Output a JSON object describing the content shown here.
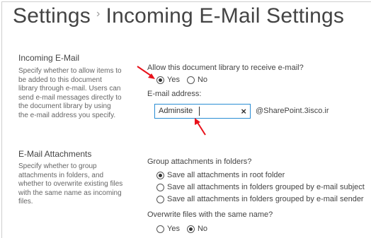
{
  "header": {
    "breadcrumb_root": "Settings",
    "separator": "›",
    "title": "Incoming E-Mail Settings"
  },
  "incoming_email": {
    "heading": "Incoming E-Mail",
    "description_lines": [
      "Specify whether to allow items to",
      "be added to this document",
      "library through e-mail. Users can",
      "send e-mail messages directly to",
      "the document library by using",
      "the e-mail address you specify."
    ],
    "allow_question": "Allow this document library to receive e-mail?",
    "allow_options": [
      {
        "label": "Yes",
        "selected": true
      },
      {
        "label": "No",
        "selected": false
      }
    ],
    "address_label": "E-mail address:",
    "address_value": "Adminsite",
    "address_domain": "@SharePoint.3isco.ir",
    "clear_icon": "×"
  },
  "attachments": {
    "heading": "E-Mail Attachments",
    "description_lines": [
      "Specify whether to group",
      "attachments in folders, and",
      "whether to overwrite existing files",
      "with the same name as incoming",
      "files."
    ],
    "group_question": "Group attachments in folders?",
    "group_options": [
      {
        "label": "Save all attachments in root folder",
        "selected": true
      },
      {
        "label": "Save all attachments in folders grouped by e-mail subject",
        "selected": false
      },
      {
        "label": "Save all attachments in folders grouped by e-mail sender",
        "selected": false
      }
    ],
    "overwrite_question": "Overwrite files with the same name?",
    "overwrite_options": [
      {
        "label": "Yes",
        "selected": false
      },
      {
        "label": "No",
        "selected": true
      }
    ]
  },
  "colors": {
    "annotation_arrow": "#e8121b",
    "input_border": "#2a8dd4",
    "text": "#444444"
  }
}
